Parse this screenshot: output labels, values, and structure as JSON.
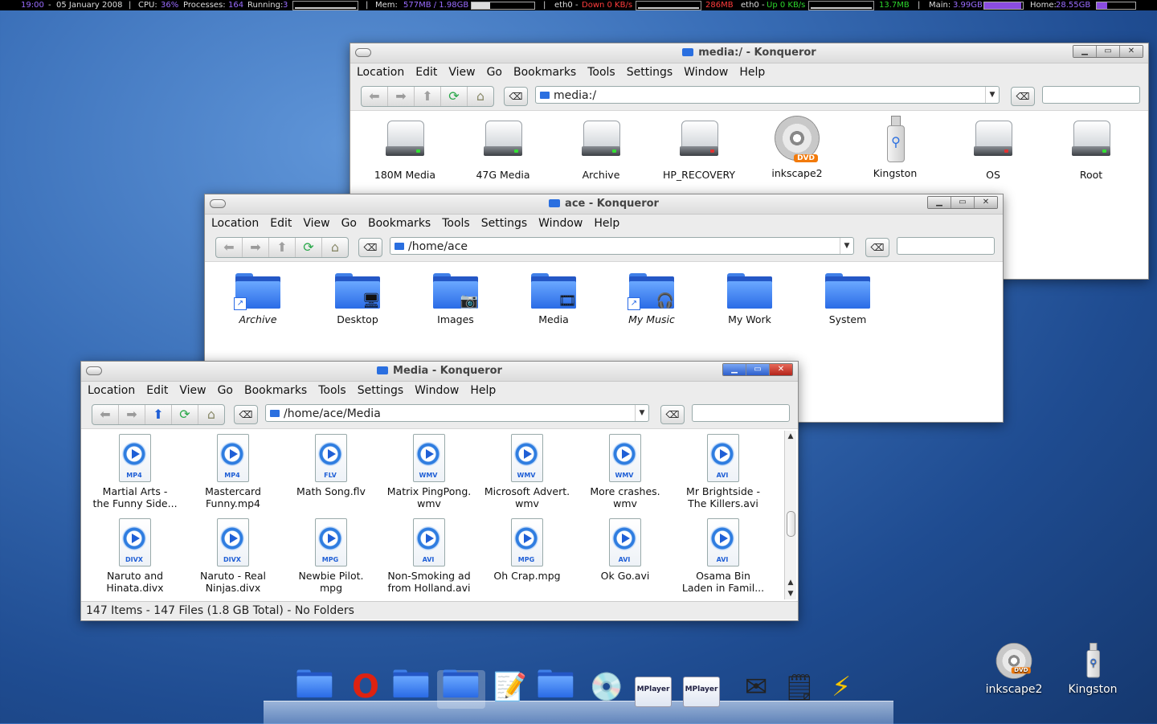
{
  "topbar": {
    "time": "19:00",
    "date": "05 January 2008",
    "cpu_label": "CPU:",
    "cpu": "36%",
    "processes_label": "Processes:",
    "processes": "164",
    "running_label": "Running:",
    "running": "3",
    "mem_label": "Mem:",
    "mem": "577MB / 1.98GB",
    "eth0_down_label": "eth0 -",
    "down": "Down 0 KB/s",
    "down_total": "286MB",
    "eth0_up_label": "eth0 -",
    "up": "Up 0 KB/s",
    "up_total": "13.7MB",
    "main_label": "Main:",
    "main": "3.99GB",
    "home_label": "Home:",
    "home": "28.55GB"
  },
  "menu": [
    "Location",
    "Edit",
    "View",
    "Go",
    "Bookmarks",
    "Tools",
    "Settings",
    "Window",
    "Help"
  ],
  "win_media_root": {
    "title": "media:/ - Konqueror",
    "url": "media:/",
    "items": [
      {
        "label": "180M Media",
        "type": "drive",
        "led": "green"
      },
      {
        "label": "47G Media",
        "type": "drive",
        "led": "green"
      },
      {
        "label": "Archive",
        "type": "drive",
        "led": "green"
      },
      {
        "label": "HP_RECOVERY",
        "type": "drive",
        "led": "red"
      },
      {
        "label": "inkscape2",
        "type": "dvd"
      },
      {
        "label": "Kingston",
        "type": "usb"
      },
      {
        "label": "OS",
        "type": "drive",
        "led": "red"
      },
      {
        "label": "Root",
        "type": "drive",
        "led": "green"
      }
    ],
    "dvd_badge": "DVD"
  },
  "win_ace": {
    "title": "ace - Konqueror",
    "url": "/home/ace",
    "items": [
      {
        "label": "Archive",
        "italic": true,
        "emblem": "link"
      },
      {
        "label": "Desktop",
        "emblem": "desktop"
      },
      {
        "label": "Images",
        "emblem": "camera"
      },
      {
        "label": "Media",
        "emblem": "film"
      },
      {
        "label": "My Music",
        "italic": true,
        "emblem": "music"
      },
      {
        "label": "My Work"
      },
      {
        "label": "System"
      }
    ]
  },
  "win_media": {
    "title": "Media - Konqueror",
    "url": "/home/ace/Media",
    "items": [
      {
        "ext": "MP4",
        "l1": "Martial Arts -",
        "l2": "the Funny Side..."
      },
      {
        "ext": "MP4",
        "l1": "Mastercard",
        "l2": "Funny.mp4"
      },
      {
        "ext": "FLV",
        "l1": "Math Song.flv",
        "l2": ""
      },
      {
        "ext": "WMV",
        "l1": "Matrix PingPong.",
        "l2": "wmv"
      },
      {
        "ext": "WMV",
        "l1": "Microsoft Advert.",
        "l2": "wmv"
      },
      {
        "ext": "WMV",
        "l1": "More crashes.",
        "l2": "wmv"
      },
      {
        "ext": "AVI",
        "l1": "Mr Brightside -",
        "l2": "The Killers.avi"
      },
      {
        "ext": "DIVX",
        "l1": "Naruto and",
        "l2": "Hinata.divx"
      },
      {
        "ext": "DIVX",
        "l1": "Naruto - Real",
        "l2": "Ninjas.divx"
      },
      {
        "ext": "MPG",
        "l1": "Newbie Pilot.",
        "l2": "mpg"
      },
      {
        "ext": "AVI",
        "l1": "Non-Smoking ad",
        "l2": "from Holland.avi"
      },
      {
        "ext": "MPG",
        "l1": "Oh Crap.mpg",
        "l2": ""
      },
      {
        "ext": "AVI",
        "l1": "Ok Go.avi",
        "l2": ""
      },
      {
        "ext": "AVI",
        "l1": "Osama Bin",
        "l2": "Laden in Famil..."
      }
    ],
    "status": "147 Items - 147 Files (1.8 GB Total) - No Folders"
  },
  "desktop": {
    "icons": [
      {
        "label": "inkscape2",
        "type": "dvd"
      },
      {
        "label": "Kingston",
        "type": "usb"
      }
    ]
  },
  "dock": {
    "items": [
      "folder-icon",
      "opera-icon",
      "folder-icon",
      "folder-icon",
      "text-editor-icon",
      "folder-icon",
      "media-player-icon",
      "mplayer-icon",
      "mplayer-icon",
      "mail-icon",
      "notes-icon",
      "power-icon"
    ],
    "mplayer_label": "MPlayer"
  }
}
